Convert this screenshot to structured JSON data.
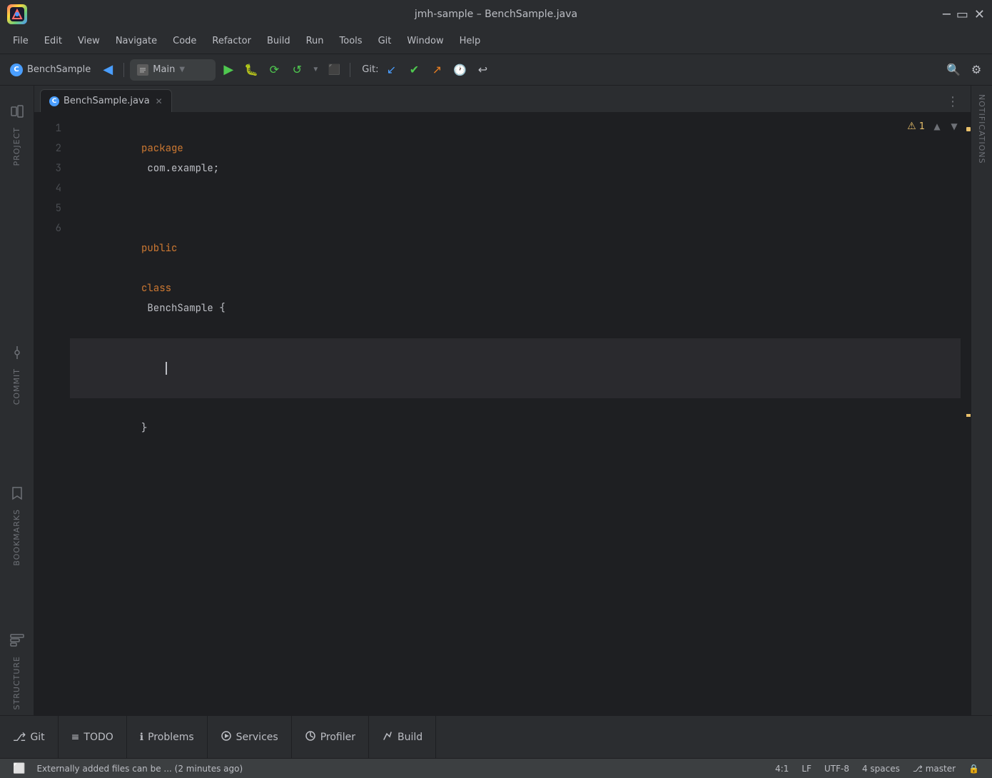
{
  "window": {
    "title": "jmh-sample – BenchSample.java",
    "logo_text": "JB"
  },
  "menu": {
    "items": [
      "File",
      "Edit",
      "View",
      "Navigate",
      "Code",
      "Refactor",
      "Build",
      "Run",
      "Tools",
      "Git",
      "Window",
      "Help"
    ]
  },
  "toolbar": {
    "run_config": "Main",
    "run_config_icon": "▣",
    "git_label": "Git:",
    "back_btn": "◀",
    "forward_btn": "▶"
  },
  "tabs": [
    {
      "name": "BenchSample.java",
      "icon": "C",
      "active": true
    }
  ],
  "editor": {
    "lines": [
      {
        "num": 1,
        "code": "package com.example;",
        "type": "package"
      },
      {
        "num": 2,
        "code": "",
        "type": "empty"
      },
      {
        "num": 3,
        "code": "public class BenchSample {",
        "type": "class"
      },
      {
        "num": 4,
        "code": "",
        "type": "empty_active"
      },
      {
        "num": 5,
        "code": "}",
        "type": "close"
      },
      {
        "num": 6,
        "code": "",
        "type": "empty"
      }
    ],
    "warning_count": "1",
    "cursor_position": "4:1"
  },
  "sidebar_left": {
    "top_items": [
      {
        "label": "Project",
        "icon": "🗂"
      },
      {
        "label": "Commit",
        "icon": "✓"
      }
    ],
    "mid_items": [
      {
        "label": "Bookmarks",
        "icon": "🔖"
      }
    ],
    "bottom_items": [
      {
        "label": "Structure",
        "icon": "⊟"
      }
    ]
  },
  "sidebar_right": {
    "label": "Notifications"
  },
  "bottom_tabs": [
    {
      "label": "Git",
      "icon": "⎇"
    },
    {
      "label": "TODO",
      "icon": "≡"
    },
    {
      "label": "Problems",
      "icon": "ℹ"
    },
    {
      "label": "Services",
      "icon": "▶"
    },
    {
      "label": "Profiler",
      "icon": "⏱"
    },
    {
      "label": "Build",
      "icon": "🔨"
    }
  ],
  "status_bar": {
    "message": "Externally added files can be ... (2 minutes ago)",
    "cursor_pos": "4:1",
    "line_ending": "LF",
    "encoding": "UTF-8",
    "indent": "4 spaces",
    "branch_icon": "⎇",
    "branch": "master",
    "lock_icon": "🔒"
  },
  "colors": {
    "bg": "#1e1f22",
    "panel": "#2b2d30",
    "accent": "#4a9eff",
    "keyword": "#cc7832",
    "warning": "#e8bf6a",
    "success": "#4fc84f",
    "error": "#e74c3c"
  }
}
